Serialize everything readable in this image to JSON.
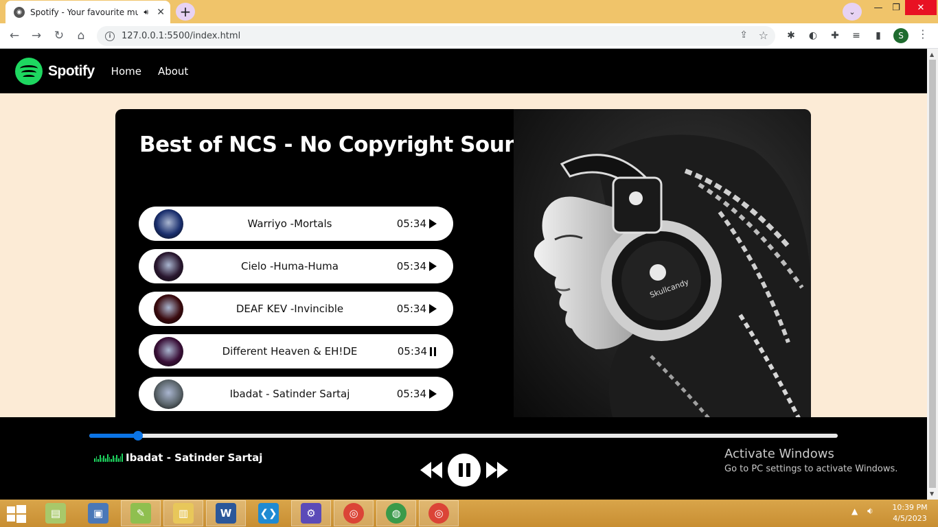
{
  "browser": {
    "tab_title": "Spotify - Your favourite music",
    "new_tab_label": "+",
    "url": "127.0.0.1:5500/index.html",
    "profile_initial": "S"
  },
  "navbar": {
    "brand": "Spotify",
    "links": [
      "Home",
      "About"
    ]
  },
  "playlist": {
    "title": "Best of NCS - No Copyright Sounds",
    "songs": [
      {
        "name": "Warriyo -Mortals",
        "duration": "05:34",
        "state": "play",
        "thumb_color": "#1a2f6e"
      },
      {
        "name": "Cielo -Huma-Huma",
        "duration": "05:34",
        "state": "play",
        "thumb_color": "#2a1830"
      },
      {
        "name": "DEAF KEV -Invincible",
        "duration": "05:34",
        "state": "play",
        "thumb_color": "#3a0a0e"
      },
      {
        "name": "Different Heaven & EH!DE",
        "duration": "05:34",
        "state": "pause",
        "thumb_color": "#3a1038"
      },
      {
        "name": "Ibadat - Satinder Sartaj",
        "duration": "05:34",
        "state": "play",
        "thumb_color": "#5a646a"
      }
    ]
  },
  "player": {
    "now_playing": "Ibadat - Satinder Sartaj",
    "progress": 0.065,
    "accent_color": "#0b74e5"
  },
  "watermark": {
    "title": "Activate Windows",
    "subtitle": "Go to PC settings to activate Windows."
  },
  "taskbar": {
    "time": "10:39 PM",
    "date": "4/5/2023",
    "apps": [
      "file-explorer-icon",
      "remote-desktop-icon",
      "notepad-plus-icon",
      "file-manager-icon",
      "word-icon",
      "vscode-icon",
      "settings-icon",
      "chrome-icon",
      "globe-app-icon",
      "chrome-profile-icon"
    ]
  }
}
